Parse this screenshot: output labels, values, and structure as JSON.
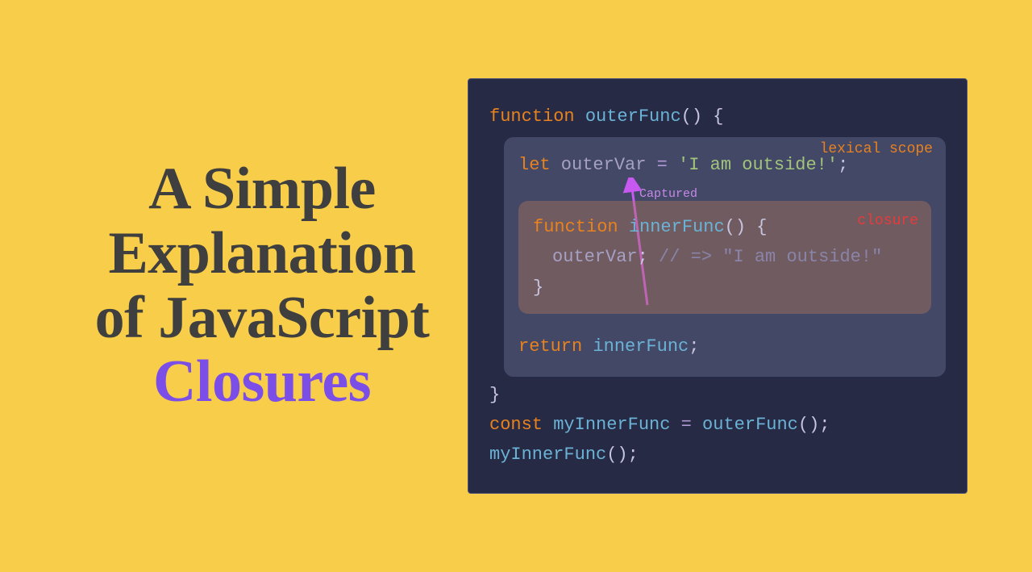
{
  "title": {
    "line1": "A Simple",
    "line2": "Explanation",
    "line3": "of JavaScript",
    "line4": "Closures"
  },
  "labels": {
    "lexical": "lexical scope",
    "closure": "closure",
    "captured": "Captured"
  },
  "code": {
    "l1_kw": "function",
    "l1_fn": " outerFunc",
    "l1_end": "() {",
    "l2_kw": "let",
    "l2_var": " outerVar ",
    "l2_op": "=",
    "l2_str": " 'I am outside!'",
    "l2_end": ";",
    "l3_kw": "function",
    "l3_fn": " innerFunc",
    "l3_end": "() {",
    "l4_var": "outerVar",
    "l4_semi": ";",
    "l4_cmt": " // => \"I am outside!\"",
    "l5": "}",
    "l6_kw": "return",
    "l6_fn": " innerFunc",
    "l6_end": ";",
    "l7": "}",
    "l8_kw": "const",
    "l8_var": " myInnerFunc ",
    "l8_op": "=",
    "l8_fn": " outerFunc",
    "l8_end": "();",
    "l9_fn": "myInnerFunc",
    "l9_end": "();"
  }
}
